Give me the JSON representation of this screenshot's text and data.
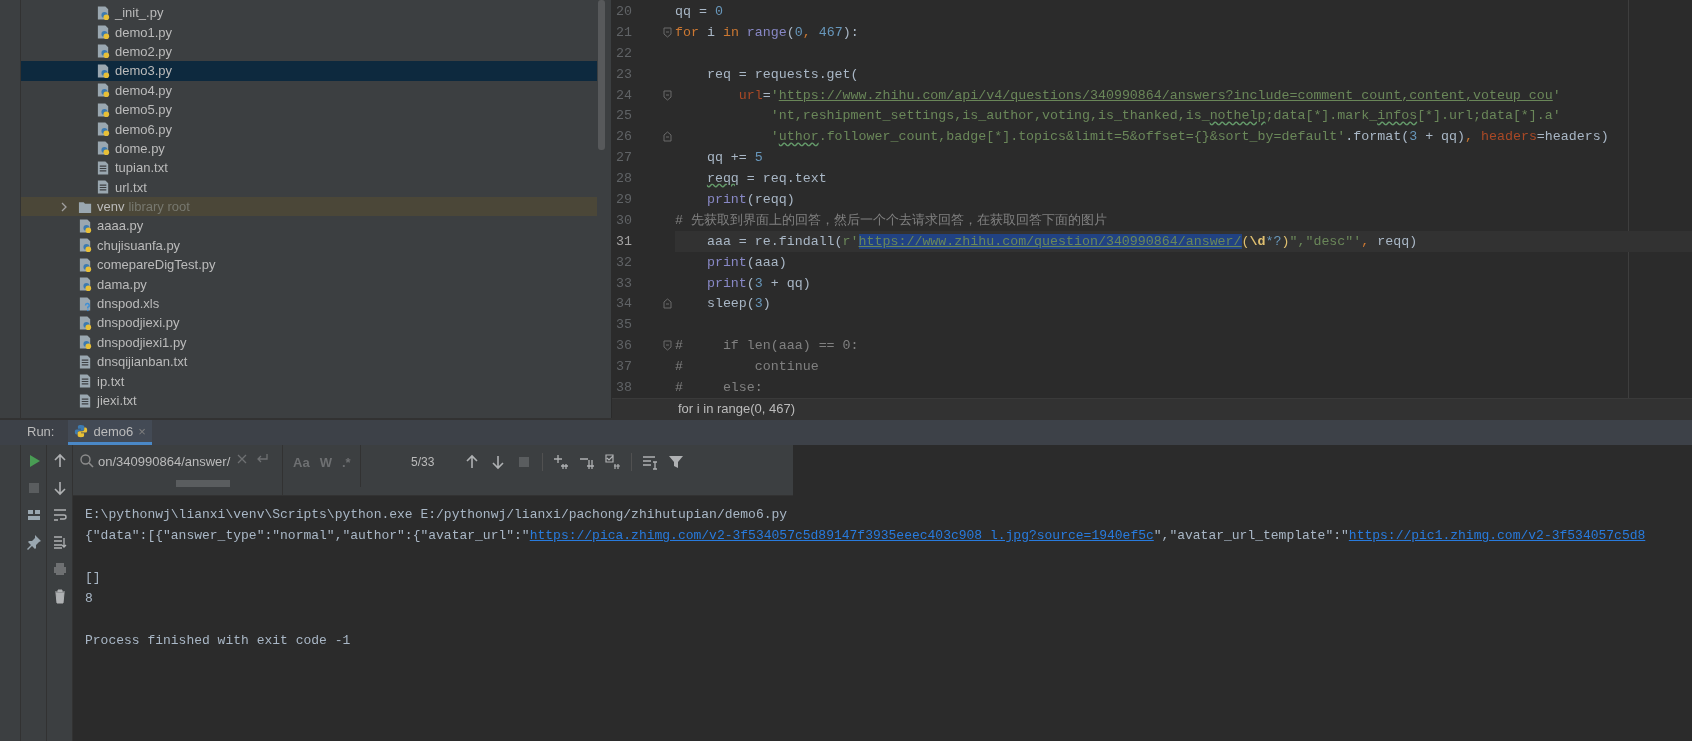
{
  "project_tree": {
    "inner_files": [
      {
        "label": "_init_.py",
        "kind": "python",
        "selected": false
      },
      {
        "label": "demo1.py",
        "kind": "python",
        "selected": false
      },
      {
        "label": "demo2.py",
        "kind": "python",
        "selected": false
      },
      {
        "label": "demo3.py",
        "kind": "python",
        "selected": true
      },
      {
        "label": "demo4.py",
        "kind": "python",
        "selected": false
      },
      {
        "label": "demo5.py",
        "kind": "python",
        "selected": false
      },
      {
        "label": "demo6.py",
        "kind": "python",
        "selected": false
      },
      {
        "label": "dome.py",
        "kind": "python",
        "selected": false
      },
      {
        "label": "tupian.txt",
        "kind": "text",
        "selected": false
      },
      {
        "label": "url.txt",
        "kind": "text",
        "selected": false
      }
    ],
    "items": [
      {
        "label": "venv",
        "hint": "library root",
        "kind": "folder",
        "expanded": false,
        "selected": false
      },
      {
        "label": "aaaa.py",
        "kind": "python",
        "selected": false
      },
      {
        "label": "chujisuanfa.py",
        "kind": "python",
        "selected": false
      },
      {
        "label": "comepareDigTest.py",
        "kind": "python",
        "selected": false
      },
      {
        "label": "dama.py",
        "kind": "python",
        "selected": false
      },
      {
        "label": "dnspod.xls",
        "kind": "unknown",
        "selected": false
      },
      {
        "label": "dnspodjiexi.py",
        "kind": "python",
        "selected": false
      },
      {
        "label": "dnspodjiexi1.py",
        "kind": "python",
        "selected": false
      },
      {
        "label": "dnsqijianban.txt",
        "kind": "text",
        "selected": false
      },
      {
        "label": "ip.txt",
        "kind": "text",
        "selected": false
      },
      {
        "label": "jiexi.txt",
        "kind": "text",
        "selected": false
      }
    ]
  },
  "editor": {
    "lines": [
      {
        "number": "20",
        "current": false,
        "fold_start": false,
        "fold_end": false,
        "tokens": [
          {
            "kind": "plain",
            "text": "qq ="
          },
          {
            "kind": "number",
            "text": " 0"
          }
        ]
      },
      {
        "number": "21",
        "current": false,
        "fold_start": true,
        "fold_end": false,
        "tokens": [
          {
            "kind": "keyword",
            "text": "for"
          },
          {
            "kind": "plain",
            "text": " i"
          },
          {
            "kind": "keyword",
            "text": " in"
          },
          {
            "kind": "builtin",
            "text": " range"
          },
          {
            "kind": "plain",
            "text": "("
          },
          {
            "kind": "number",
            "text": "0"
          },
          {
            "kind": "keyword",
            "text": ","
          },
          {
            "kind": "number",
            "text": " 467"
          },
          {
            "kind": "plain",
            "text": "):"
          }
        ]
      },
      {
        "number": "22",
        "current": false,
        "fold_start": false,
        "fold_end": false
      },
      {
        "number": "23",
        "current": false,
        "fold_start": false,
        "fold_end": false,
        "tokens": [
          {
            "kind": "plain",
            "text": "    req = requests.get("
          }
        ]
      },
      {
        "number": "24",
        "current": false,
        "fold_start": true,
        "fold_end": false,
        "tokens": [
          {
            "kind": "param",
            "text": "        url"
          },
          {
            "kind": "plain",
            "text": "="
          },
          {
            "kind": "string",
            "text": "'"
          },
          {
            "kind": "link",
            "text": "https://www.zhihu.com/api/v4/questions/340990864/answers?include=comment_count,content,voteup_cou"
          },
          {
            "kind": "string",
            "text": "'"
          }
        ]
      },
      {
        "number": "25",
        "current": false,
        "fold_start": false,
        "fold_end": false,
        "tokens": [
          {
            "kind": "string",
            "text": "            'nt,reshipment_settings,is_author,voting,is_thanked,is_"
          },
          {
            "kind": "string",
            "text": "nothelp",
            "typo": true
          },
          {
            "kind": "string",
            "text": ";data[*].mark_"
          },
          {
            "kind": "string",
            "text": "infos",
            "typo": true
          },
          {
            "kind": "string",
            "text": "[*].url;data[*].a'"
          }
        ]
      },
      {
        "number": "26",
        "current": false,
        "fold_start": false,
        "fold_end": true,
        "tokens": [
          {
            "kind": "string",
            "text": "            '"
          },
          {
            "kind": "string",
            "text": "uthor",
            "typo": true
          },
          {
            "kind": "string",
            "text": ".follower_count,badge[*].topics&limit=5&offset={}&sort_by=default'"
          },
          {
            "kind": "plain",
            "text": ".format("
          },
          {
            "kind": "number",
            "text": "3"
          },
          {
            "kind": "plain",
            "text": " + qq)"
          },
          {
            "kind": "keyword",
            "text": ","
          },
          {
            "kind": "param",
            "text": " headers"
          },
          {
            "kind": "plain",
            "text": "=headers)"
          }
        ]
      },
      {
        "number": "27",
        "current": false,
        "fold_start": false,
        "fold_end": false,
        "tokens": [
          {
            "kind": "plain",
            "text": "    qq +="
          },
          {
            "kind": "number",
            "text": " 5"
          }
        ]
      },
      {
        "number": "28",
        "current": false,
        "fold_start": false,
        "fold_end": false,
        "tokens": [
          {
            "kind": "plain",
            "text": "    reqq",
            "typo": true
          },
          {
            "kind": "plain",
            "text": " = req.text"
          }
        ]
      },
      {
        "number": "29",
        "current": false,
        "fold_start": false,
        "fold_end": false,
        "tokens": [
          {
            "kind": "builtin",
            "text": "    print"
          },
          {
            "kind": "plain",
            "text": "(reqq)"
          }
        ]
      },
      {
        "number": "30",
        "current": false,
        "fold_start": false,
        "fold_end": false,
        "tokens": [
          {
            "kind": "comment",
            "text": "# 先获取到界面上的回答，然后一个个去请求回答，在获取回答下面的图片"
          }
        ]
      },
      {
        "number": "31",
        "current": true,
        "fold_start": false,
        "fold_end": false,
        "tokens": [
          {
            "kind": "plain",
            "text": "    aaa = re.findall("
          },
          {
            "kind": "string",
            "text": "r'"
          },
          {
            "kind": "selected-link",
            "text": "https://www.zhihu.com/question/340990864/answer/"
          },
          {
            "kind": "regex-group",
            "text": "("
          },
          {
            "kind": "regex-escape",
            "text": "\\d"
          },
          {
            "kind": "regex-quant",
            "text": "*?"
          },
          {
            "kind": "regex-group",
            "text": ")"
          },
          {
            "kind": "string",
            "text": "\",\"desc\"'"
          },
          {
            "kind": "keyword",
            "text": ","
          },
          {
            "kind": "plain",
            "text": " reqq)"
          }
        ]
      },
      {
        "number": "32",
        "current": false,
        "fold_start": false,
        "fold_end": false,
        "tokens": [
          {
            "kind": "builtin",
            "text": "    print"
          },
          {
            "kind": "plain",
            "text": "(aaa)"
          }
        ]
      },
      {
        "number": "33",
        "current": false,
        "fold_start": false,
        "fold_end": false,
        "tokens": [
          {
            "kind": "builtin",
            "text": "    print"
          },
          {
            "kind": "plain",
            "text": "("
          },
          {
            "kind": "number",
            "text": "3"
          },
          {
            "kind": "plain",
            "text": " + qq)"
          }
        ]
      },
      {
        "number": "34",
        "current": false,
        "fold_start": false,
        "fold_end": true,
        "tokens": [
          {
            "kind": "plain",
            "text": "    sleep("
          },
          {
            "kind": "number",
            "text": "3"
          },
          {
            "kind": "plain",
            "text": ")"
          }
        ]
      },
      {
        "number": "35",
        "current": false,
        "fold_start": false,
        "fold_end": false
      },
      {
        "number": "36",
        "current": false,
        "fold_start": true,
        "fold_end": false,
        "tokens": [
          {
            "kind": "comment",
            "text": "#     if len(aaa) == 0:"
          }
        ]
      },
      {
        "number": "37",
        "current": false,
        "fold_start": false,
        "fold_end": false,
        "tokens": [
          {
            "kind": "comment",
            "text": "#         continue"
          }
        ]
      },
      {
        "number": "38",
        "current": false,
        "fold_start": false,
        "fold_end": false,
        "tokens": [
          {
            "kind": "comment",
            "text": "#     else:"
          }
        ]
      }
    ],
    "breadcrumb": "for i in range(0, 467)"
  },
  "run_panel": {
    "label": "Run:",
    "tabs": [
      {
        "label": "demo6",
        "selected": true,
        "close": "×"
      }
    ],
    "search": {
      "value": "on/340990864/answer/",
      "toggles": [
        {
          "label": "Aa",
          "on": false
        },
        {
          "label": "W",
          "on": false
        },
        {
          "label": ".*",
          "on": false
        }
      ],
      "match_count": "5/33"
    },
    "output": [
      {
        "blank_before": false,
        "tokens": [
          {
            "kind": "plain",
            "text": "E:\\pythonwj\\lianxi\\venv\\Scripts\\python.exe E:/pythonwj/lianxi/pachong/zhihutupian/demo6.py"
          }
        ]
      },
      {
        "blank_before": false,
        "tokens": [
          {
            "kind": "plain",
            "text": "{\"data\":[{\"answer_type\":\"normal\",\"author\":{\"avatar_url\":\""
          },
          {
            "kind": "link",
            "text": "https://pica.zhimg.com/v2-3f534057c5d89147f3935eeec403c908_l.jpg?source=1940ef5c"
          },
          {
            "kind": "plain",
            "text": "\",\"avatar_url_template\":\""
          },
          {
            "kind": "link",
            "text": "https://pic1.zhimg.com/v2-3f534057c5d8"
          }
        ]
      },
      {
        "blank_before": true,
        "tokens": [
          {
            "kind": "plain",
            "text": "[]"
          }
        ]
      },
      {
        "blank_before": false,
        "tokens": [
          {
            "kind": "plain",
            "text": "8"
          }
        ]
      },
      {
        "blank_before": true,
        "tokens": [
          {
            "kind": "plain",
            "text": "Process finished with exit code -1"
          }
        ]
      }
    ]
  }
}
